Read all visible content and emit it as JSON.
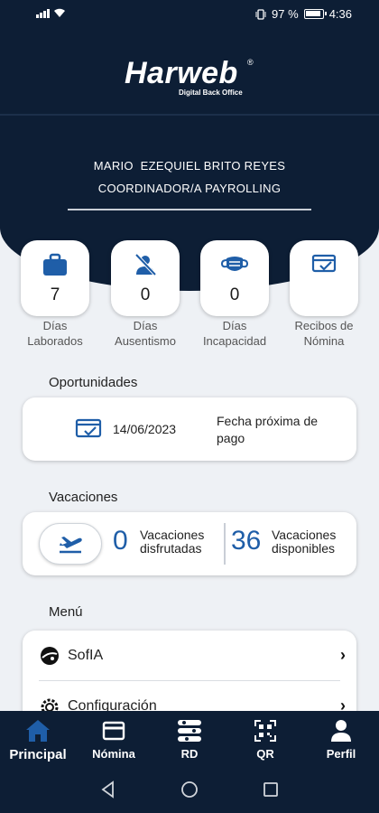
{
  "status_bar": {
    "battery_text": "97 %",
    "time": "4:36"
  },
  "logo": {
    "name": "Harweb",
    "reg": "®",
    "subtitle": "Digital Back Office"
  },
  "user": {
    "name": "MARIO  EZEQUIEL BRITO REYES",
    "role": "COORDINADOR/A PAYROLLING"
  },
  "stats": [
    {
      "icon": "briefcase-icon",
      "value": "7",
      "label_line1": "Días",
      "label_line2": "Laborados"
    },
    {
      "icon": "person-off-icon",
      "value": "0",
      "label_line1": "Días",
      "label_line2": "Ausentismo"
    },
    {
      "icon": "mask-icon",
      "value": "0",
      "label_line1": "Días",
      "label_line2": "Incapacidad"
    },
    {
      "icon": "receipt-check-icon",
      "value": "",
      "label_line1": "Recibos de",
      "label_line2": "Nómina"
    }
  ],
  "opportunities": {
    "title": "Oportunidades",
    "date": "14/06/2023",
    "label": "Fecha próxima de pago"
  },
  "vacations": {
    "title": "Vacaciones",
    "taken_value": "0",
    "taken_line1": "Vacaciones",
    "taken_line2": "disfrutadas",
    "available_value": "36",
    "available_line1": "Vacaciones",
    "available_line2": "disponibles"
  },
  "menu": {
    "title": "Menú",
    "items": [
      {
        "label": "SofIA",
        "icon": "sofia-logo-icon"
      },
      {
        "label": "Configuración",
        "icon": "gear-icon"
      }
    ]
  },
  "bottom_nav": [
    {
      "label": "Principal",
      "icon": "home-icon",
      "active": true
    },
    {
      "label": "Nómina",
      "icon": "card-icon"
    },
    {
      "label": "RD",
      "icon": "rd-icon"
    },
    {
      "label": "QR",
      "icon": "qr-icon"
    },
    {
      "label": "Perfil",
      "icon": "user-icon"
    }
  ],
  "colors": {
    "header": "#0d1e35",
    "accent": "#1f5ea8",
    "background": "#eef1f5"
  }
}
